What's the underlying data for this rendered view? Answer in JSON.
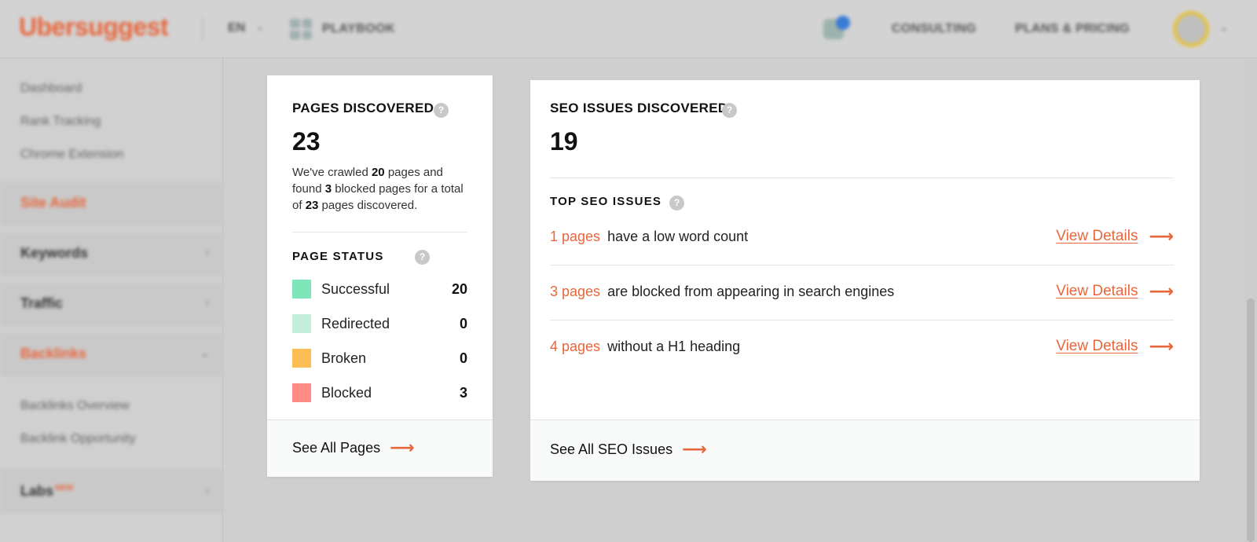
{
  "header": {
    "logo": "Ubersuggest",
    "language": "EN",
    "playbook": "PLAYBOOK",
    "nav_consulting": "CONSULTING",
    "nav_plans": "PLANS & PRICING"
  },
  "sidebar": {
    "links_top": [
      "Dashboard",
      "Rank Tracking",
      "Chrome Extension"
    ],
    "site_audit": "Site Audit",
    "keywords": "Keywords",
    "traffic": "Traffic",
    "backlinks": "Backlinks",
    "backlinks_sub": [
      "Backlinks Overview",
      "Backlink Opportunity"
    ],
    "labs": "Labs",
    "labs_badge": "NEW"
  },
  "pages_card": {
    "title": "PAGES DISCOVERED",
    "total": "23",
    "desc_1": "We've crawled ",
    "crawled": "20",
    "desc_2": " pages and found ",
    "blocked": "3",
    "desc_3": " blocked pages for a total of ",
    "total_inline": "23",
    "desc_4": " pages discovered.",
    "status_title": "PAGE STATUS",
    "statuses": [
      {
        "label": "Successful",
        "count": "20",
        "color": "#7ee5bb"
      },
      {
        "label": "Redirected",
        "count": "0",
        "color": "#c4eedb"
      },
      {
        "label": "Broken",
        "count": "0",
        "color": "#fbbd54"
      },
      {
        "label": "Blocked",
        "count": "3",
        "color": "#ff8a86"
      }
    ],
    "footer_link": "See All Pages"
  },
  "seo_card": {
    "title": "SEO ISSUES DISCOVERED",
    "total": "19",
    "top_title": "TOP SEO ISSUES",
    "issues": [
      {
        "count": "1 pages",
        "text": "have a low word count",
        "action": "View Details"
      },
      {
        "count": "3 pages",
        "text": "are blocked from appearing in search engines",
        "action": "View Details"
      },
      {
        "count": "4 pages",
        "text": "without a H1 heading",
        "action": "View Details"
      }
    ],
    "footer_link": "See All SEO Issues"
  },
  "colors": {
    "accent": "#e8663b"
  }
}
